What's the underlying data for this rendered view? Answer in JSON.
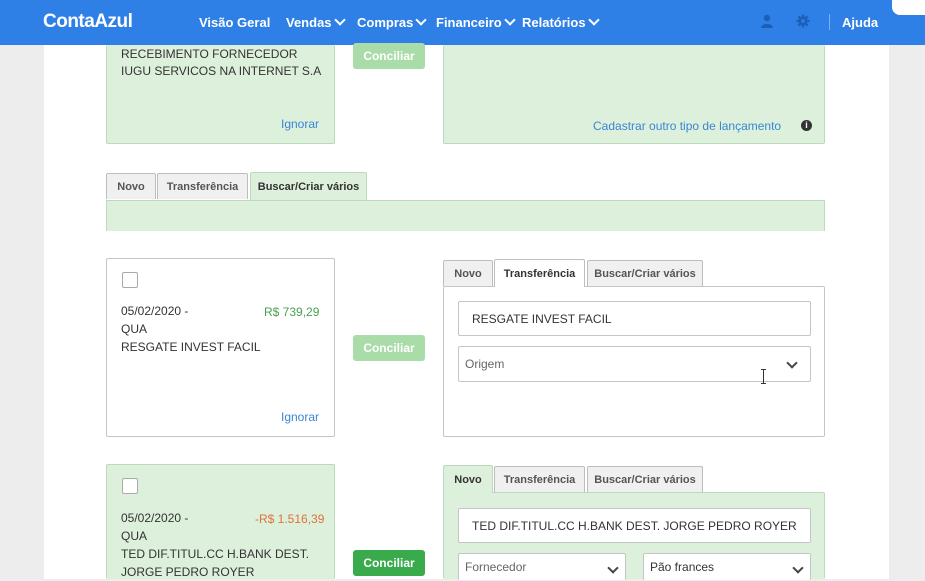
{
  "header": {
    "logo": "ContaAzul",
    "nav": [
      "Visão Geral",
      "Vendas",
      "Compras",
      "Financeiro",
      "Relatórios"
    ],
    "help": "Ajuda"
  },
  "row1": {
    "left_lines": [
      "RECEBIMENTO FORNECEDOR",
      "IUGU SERVICOS NA INTERNET S.A"
    ],
    "ignore": "Ignorar",
    "button": "Conciliar",
    "right_link": "Cadastrar outro tipo de lançamento"
  },
  "row2": {
    "tabs": [
      "Novo",
      "Transferência",
      "Buscar/Criar vários"
    ]
  },
  "row3": {
    "date": "05/02/2020 -",
    "weekday": "QUA",
    "description": "RESGATE INVEST FACIL",
    "amount": "R$ 739,29",
    "ignore": "Ignorar",
    "button": "Conciliar",
    "tabs": [
      "Novo",
      "Transferência",
      "Buscar/Criar vários"
    ],
    "input_value": "RESGATE INVEST FACIL",
    "select_placeholder": "Origem"
  },
  "row4": {
    "date": "05/02/2020 -",
    "weekday": "QUA",
    "description_lines": [
      "TED DIF.TITUL.CC H.BANK DEST.",
      "JORGE PEDRO ROYER"
    ],
    "amount": "-R$ 1.516,39",
    "button": "Conciliar",
    "tabs": [
      "Novo",
      "Transferência",
      "Buscar/Criar vários"
    ],
    "input_value": "TED DIF.TITUL.CC H.BANK DEST. JORGE PEDRO ROYER",
    "select1_placeholder": "Fornecedor",
    "select2_value": "Pão frances"
  },
  "colors": {
    "primary": "#2f80e6",
    "success": "#3aab4c",
    "success_light": "#ddf0dc",
    "positive_amount": "#4aa14f",
    "negative_amount": "#e0713c",
    "link": "#3a86d5"
  }
}
